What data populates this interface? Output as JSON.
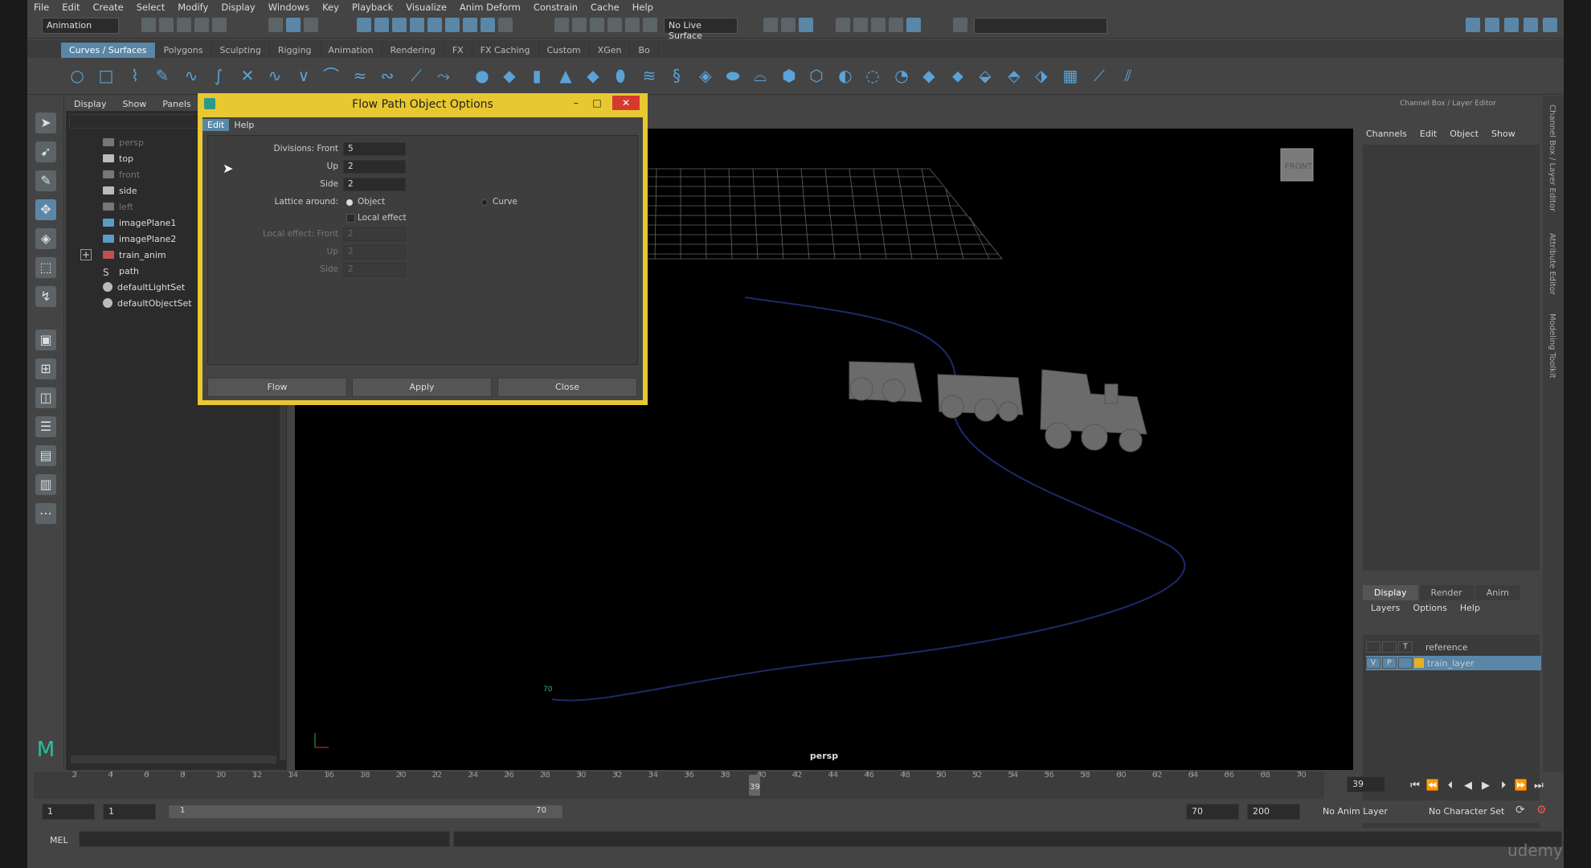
{
  "menubar": [
    "File",
    "Edit",
    "Create",
    "Select",
    "Modify",
    "Display",
    "Windows",
    "Key",
    "Playback",
    "Visualize",
    "Anim Deform",
    "Constrain",
    "Cache",
    "Help"
  ],
  "status": {
    "mode": "Animation",
    "live_surface": "No Live Surface"
  },
  "shelf_tabs": [
    "Curves / Surfaces",
    "Polygons",
    "Sculpting",
    "Rigging",
    "Animation",
    "Rendering",
    "FX",
    "FX Caching",
    "Custom",
    "XGen",
    "Bo"
  ],
  "outliner": {
    "menu": [
      "Display",
      "Show",
      "Panels"
    ],
    "items": [
      {
        "label": "persp",
        "dim": true
      },
      {
        "label": "top",
        "dim": false
      },
      {
        "label": "front",
        "dim": true
      },
      {
        "label": "side",
        "dim": false
      },
      {
        "label": "left",
        "dim": true
      },
      {
        "label": "imagePlane1",
        "dim": false
      },
      {
        "label": "imagePlane2",
        "dim": false
      },
      {
        "label": "train_anim",
        "dim": false
      },
      {
        "label": "path",
        "dim": false
      },
      {
        "label": "defaultLightSet",
        "dim": false
      },
      {
        "label": "defaultObjectSet",
        "dim": false
      }
    ]
  },
  "dialog": {
    "title": "Flow Path Object Options",
    "menu": [
      "Edit",
      "Help"
    ],
    "fields": {
      "div_front": {
        "label": "Divisions: Front",
        "value": "5"
      },
      "up": {
        "label": "Up",
        "value": "2"
      },
      "side": {
        "label": "Side",
        "value": "2"
      },
      "lattice_label": "Lattice around:",
      "opt_object": "Object",
      "opt_curve": "Curve",
      "local_effect": "Local effect",
      "le_front": {
        "label": "Local effect: Front",
        "value": "2"
      },
      "le_up": {
        "label": "Up",
        "value": "2"
      },
      "le_side": {
        "label": "Side",
        "value": "2"
      }
    },
    "buttons": {
      "flow": "Flow",
      "apply": "Apply",
      "close": "Close"
    }
  },
  "viewport": {
    "camera_label": "persp",
    "cube_label": "FRONT",
    "path_marker": "70"
  },
  "channel_box": {
    "title": "Channel Box / Layer Editor",
    "menu": [
      "Channels",
      "Edit",
      "Object",
      "Show"
    ],
    "layer_tabs": [
      "Display",
      "Render",
      "Anim"
    ],
    "layer_menu": [
      "Layers",
      "Options",
      "Help"
    ],
    "layers": [
      {
        "name": "reference",
        "v": "",
        "p": "",
        "t": "T"
      },
      {
        "name": "train_layer",
        "v": "V",
        "p": "P",
        "t": ""
      }
    ],
    "side_tabs": [
      "Channel Box / Layer Editor",
      "Attribute Editor",
      "Modeling Toolkit"
    ]
  },
  "timeline": {
    "ticks": [
      2,
      4,
      6,
      8,
      10,
      12,
      14,
      16,
      18,
      20,
      22,
      24,
      26,
      28,
      30,
      32,
      34,
      36,
      38,
      40,
      42,
      44,
      46,
      48,
      50,
      52,
      54,
      56,
      58,
      60,
      62,
      64,
      66,
      68,
      70
    ],
    "current": "39",
    "start": 1,
    "end": 70
  },
  "range": {
    "start": "1",
    "start2": "1",
    "slider_start": "1",
    "slider_end": "70",
    "end": "70",
    "end2": "200",
    "anim_layer": "No Anim Layer",
    "char_set": "No Character Set"
  },
  "cmdline": {
    "label": "MEL"
  },
  "watermark": "udemy"
}
